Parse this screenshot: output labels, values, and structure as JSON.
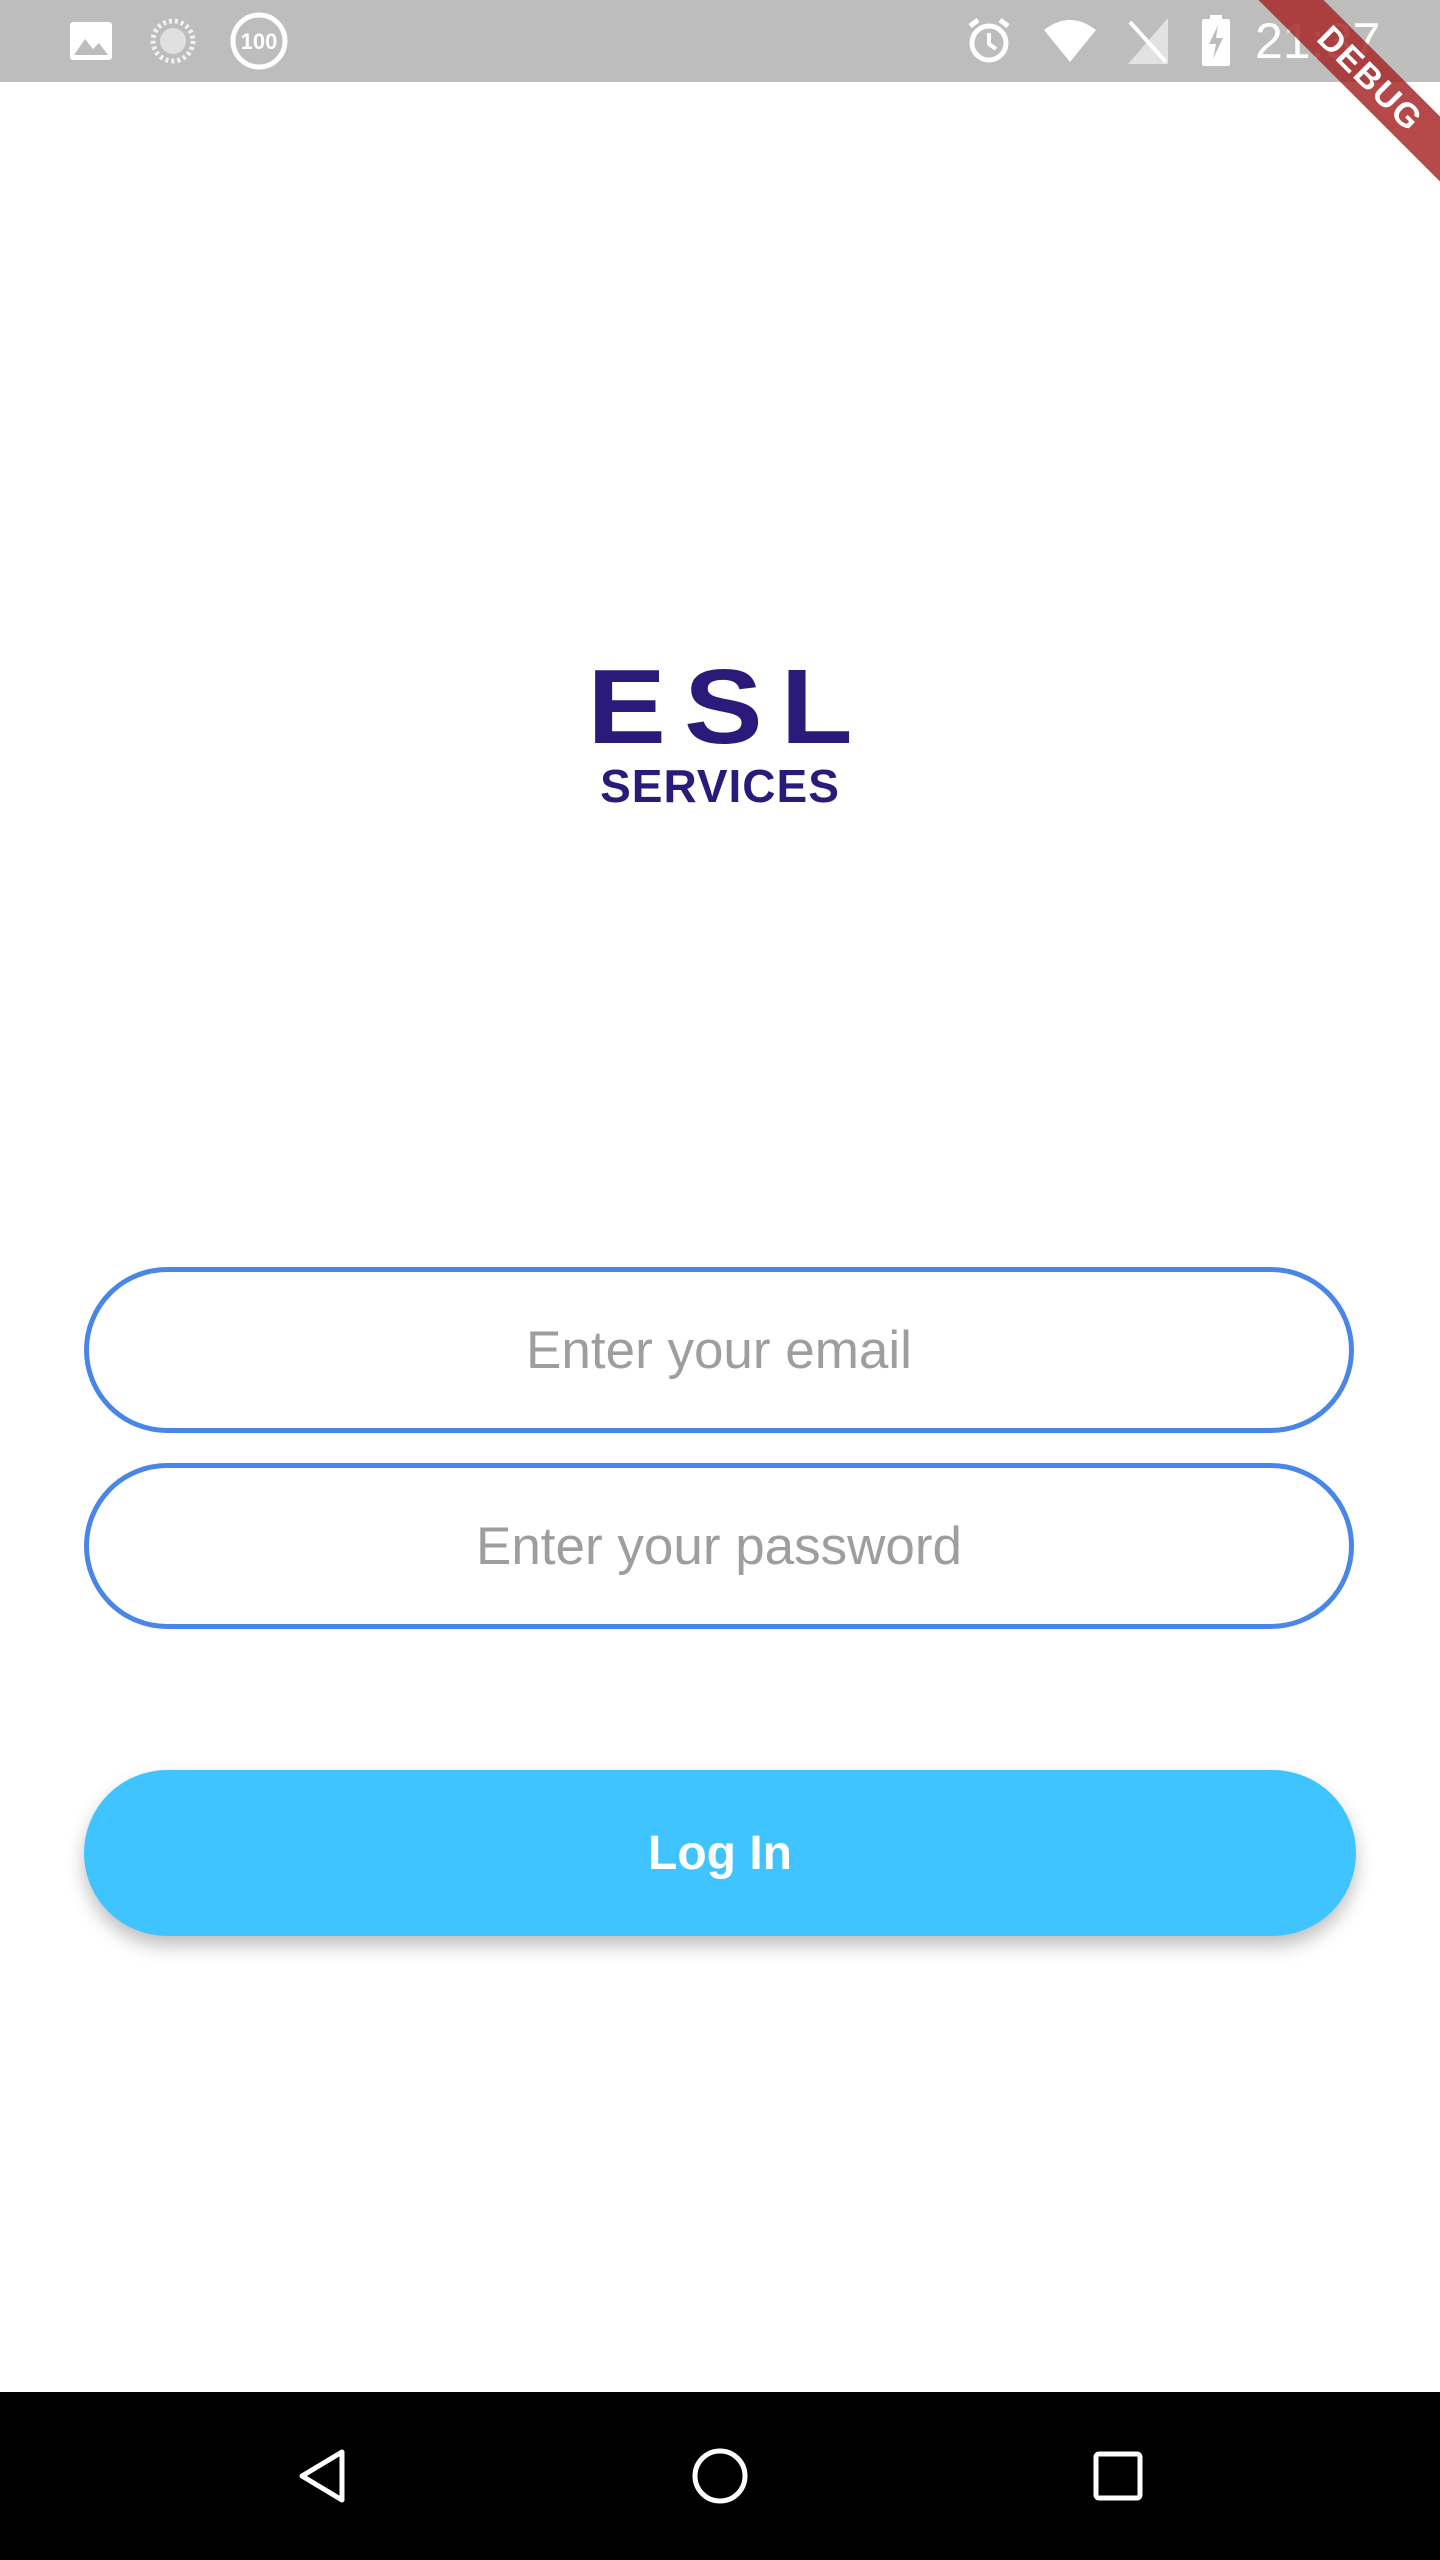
{
  "status_bar": {
    "time": "21:37",
    "icons": [
      "image-icon",
      "loading-circle-icon",
      "100-badge-icon",
      "alarm-icon",
      "wifi-icon",
      "no-sim-icon",
      "battery-charging-icon"
    ],
    "left_badge_text": "100"
  },
  "debug_banner": {
    "label": "DEBUG"
  },
  "logo": {
    "main": "ESL",
    "sub": "SERVICES",
    "color": "#2c1a7a"
  },
  "form": {
    "email": {
      "value": "",
      "placeholder": "Enter your email"
    },
    "password": {
      "value": "",
      "placeholder": "Enter your password"
    },
    "login_label": "Log In"
  },
  "nav_bar": {
    "icons": [
      "back-icon",
      "home-icon",
      "recents-icon"
    ]
  },
  "colors": {
    "accent_border": "#4a86e8",
    "button": "#40c4ff",
    "status_bar": "#bdbdbd",
    "placeholder": "#9e9e9e"
  }
}
